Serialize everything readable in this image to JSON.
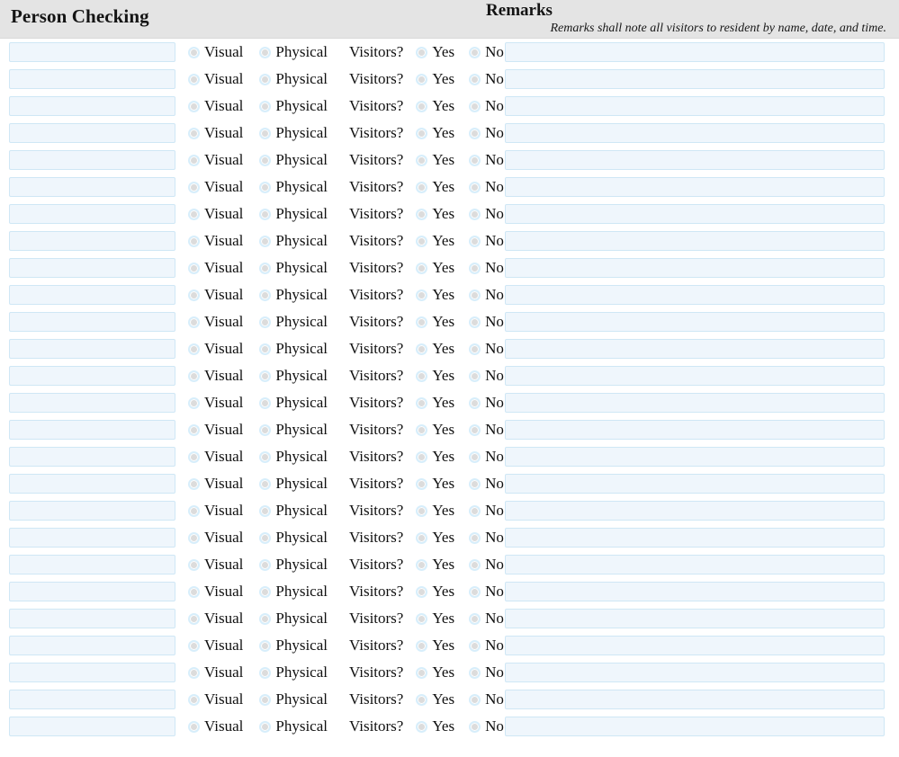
{
  "header": {
    "left_title": "Person Checking",
    "right_title": "Remarks",
    "right_subtitle": "Remarks shall note all visitors to resident by name, date, and time."
  },
  "row_template": {
    "person_value": "",
    "person_placeholder": "",
    "visual_label": "Visual",
    "physical_label": "Physical",
    "visitors_question": "Visitors?",
    "yes_label": "Yes",
    "no_label": "No",
    "remarks_value": "",
    "remarks_placeholder": ""
  },
  "row_count": 26,
  "colors": {
    "header_background": "#e4e4e4",
    "input_background": "#eff6fc",
    "input_border": "#cfe7f5",
    "radio_ring": "#d7eefb",
    "radio_fill": "#dcdcdc",
    "text": "#101010",
    "page_background": "#ffffff"
  },
  "icons": {
    "radio_visual": "radio-button-icon",
    "radio_physical": "radio-button-icon",
    "radio_yes": "radio-button-icon",
    "radio_no": "radio-button-icon"
  }
}
